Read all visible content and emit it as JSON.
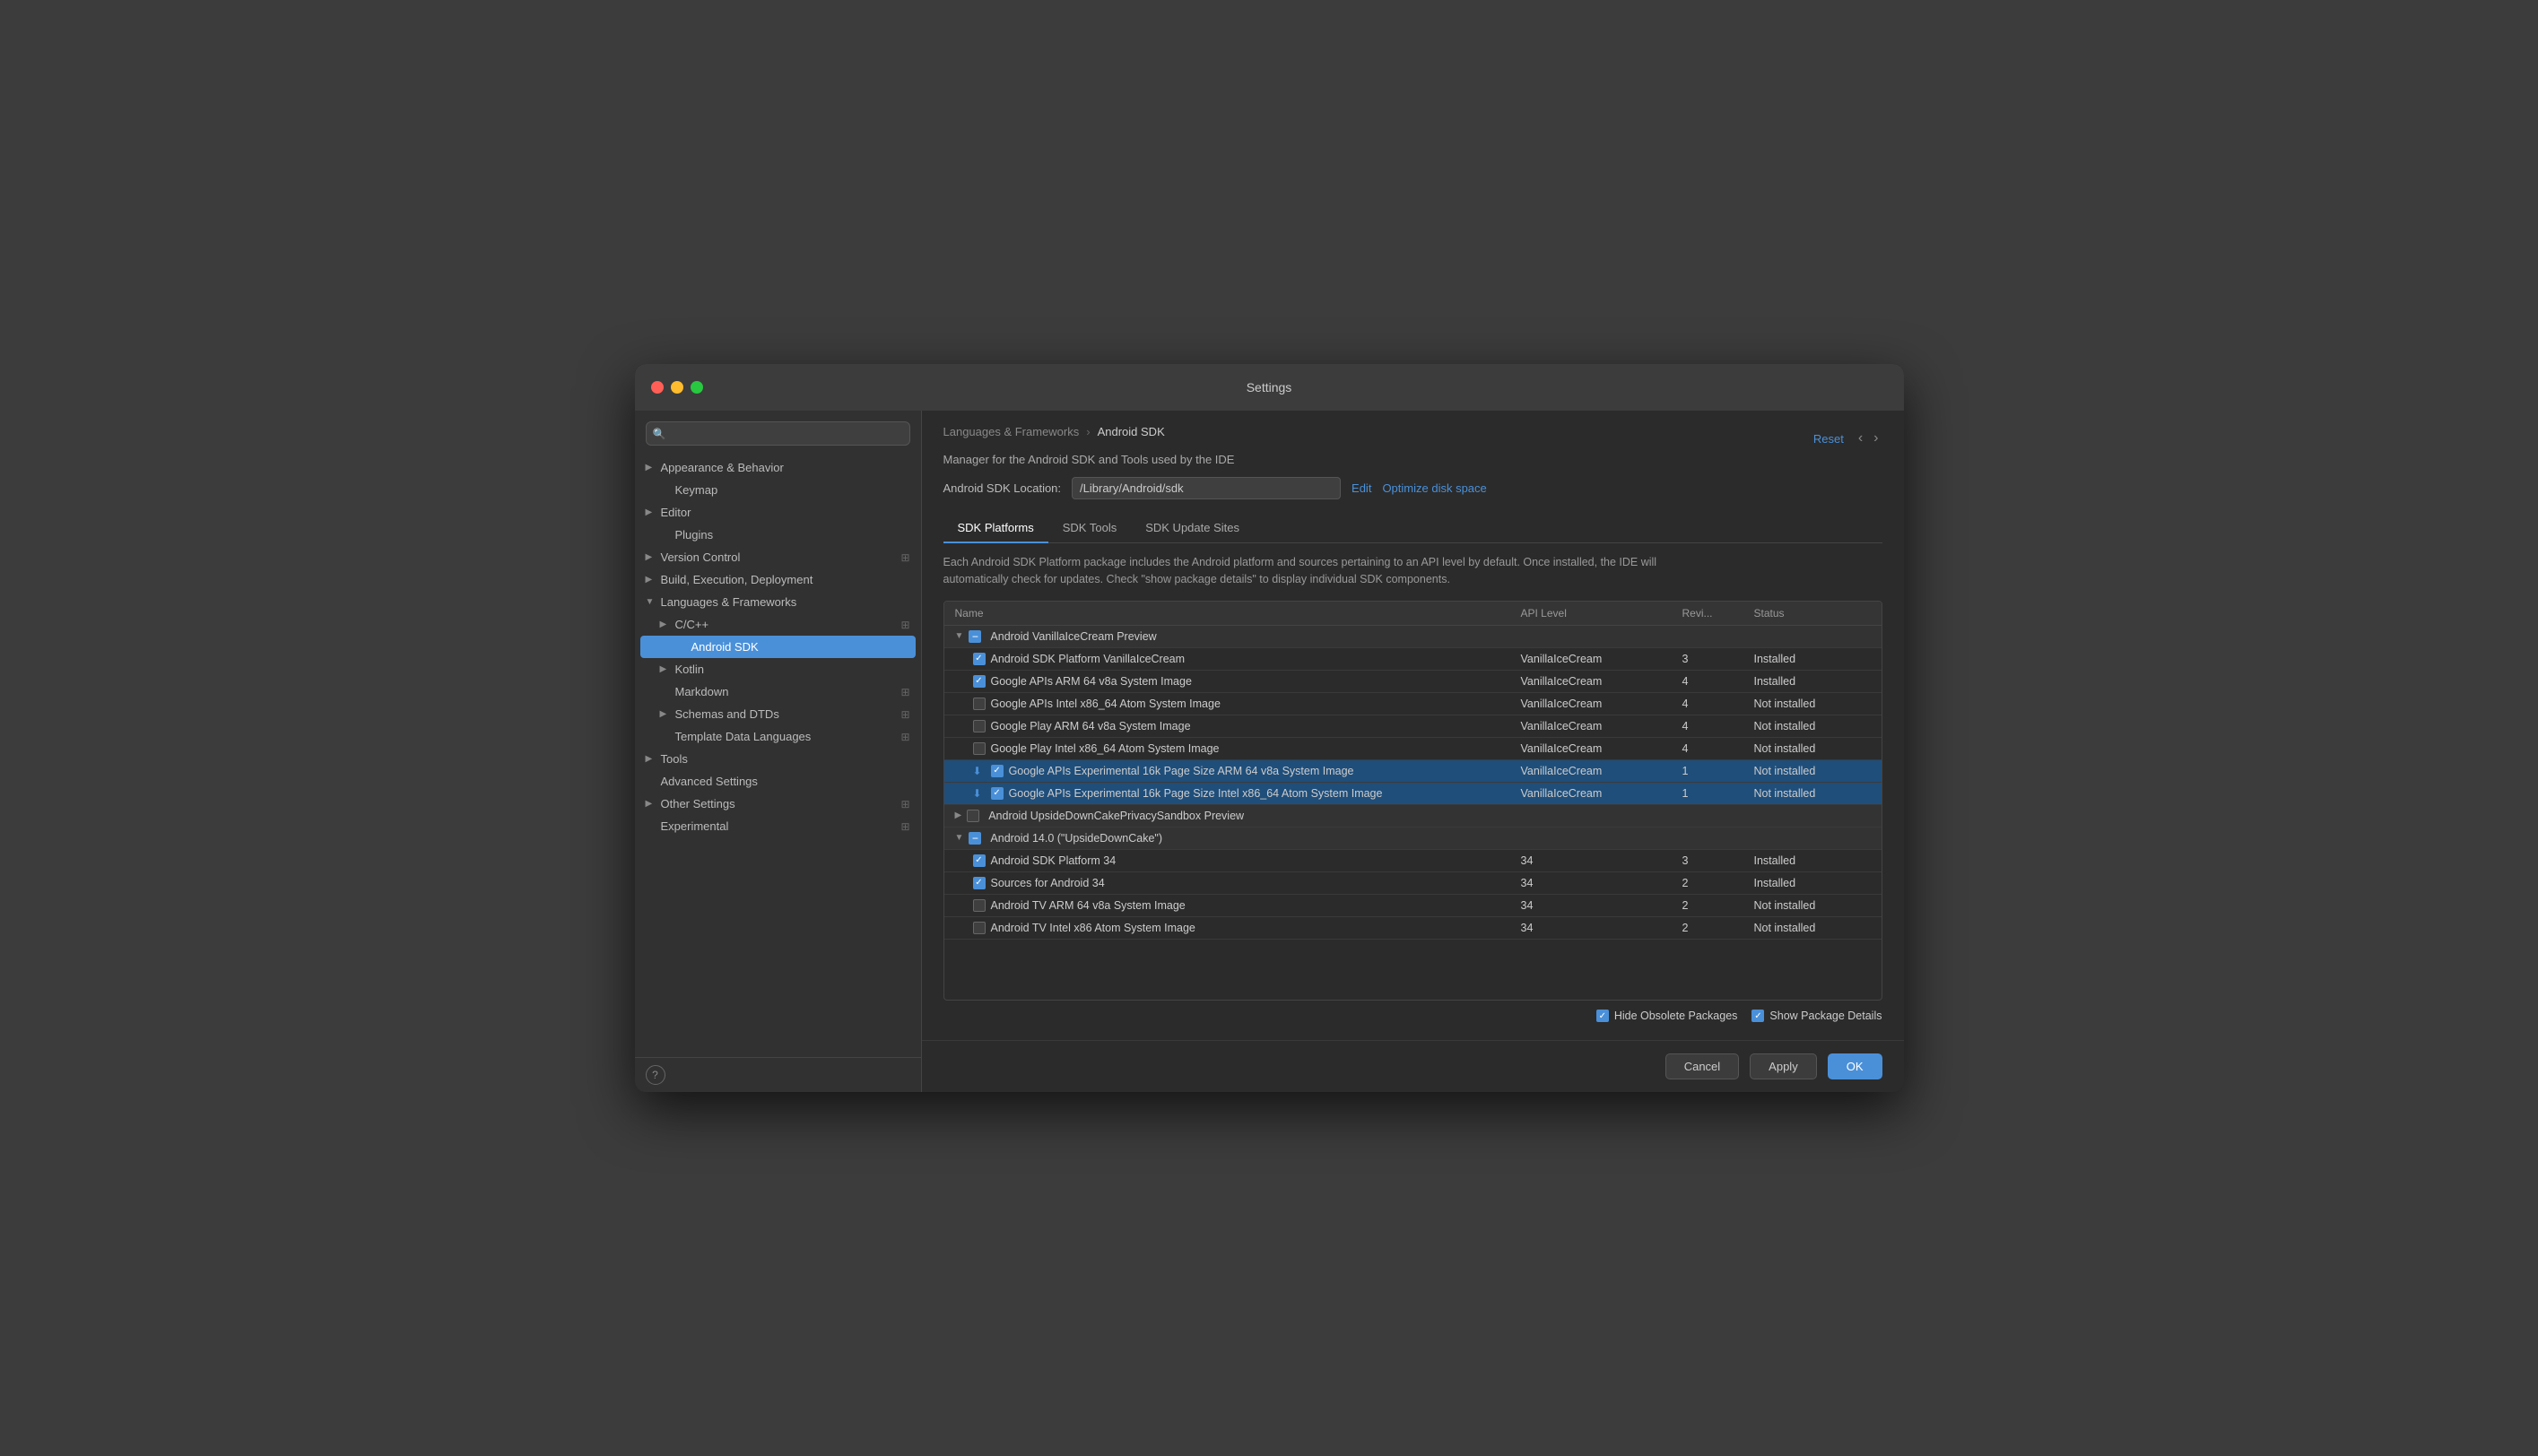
{
  "window": {
    "title": "Settings"
  },
  "sidebar": {
    "search_placeholder": "🔍",
    "items": [
      {
        "id": "appearance",
        "label": "Appearance & Behavior",
        "level": 0,
        "arrow": "▶",
        "icon_right": false,
        "active": false
      },
      {
        "id": "keymap",
        "label": "Keymap",
        "level": 1,
        "arrow": "",
        "icon_right": false,
        "active": false
      },
      {
        "id": "editor",
        "label": "Editor",
        "level": 0,
        "arrow": "▶",
        "icon_right": false,
        "active": false
      },
      {
        "id": "plugins",
        "label": "Plugins",
        "level": 1,
        "arrow": "",
        "icon_right": false,
        "active": false
      },
      {
        "id": "version-control",
        "label": "Version Control",
        "level": 0,
        "arrow": "▶",
        "icon_right": true,
        "active": false
      },
      {
        "id": "build-execution",
        "label": "Build, Execution, Deployment",
        "level": 0,
        "arrow": "▶",
        "icon_right": false,
        "active": false
      },
      {
        "id": "languages-frameworks",
        "label": "Languages & Frameworks",
        "level": 0,
        "arrow": "▼",
        "icon_right": false,
        "active": false
      },
      {
        "id": "cpp",
        "label": "C/C++",
        "level": 1,
        "arrow": "▶",
        "icon_right": true,
        "active": false
      },
      {
        "id": "android-sdk",
        "label": "Android SDK",
        "level": 2,
        "arrow": "",
        "icon_right": false,
        "active": true
      },
      {
        "id": "kotlin",
        "label": "Kotlin",
        "level": 1,
        "arrow": "▶",
        "icon_right": false,
        "active": false
      },
      {
        "id": "markdown",
        "label": "Markdown",
        "level": 1,
        "arrow": "",
        "icon_right": true,
        "active": false
      },
      {
        "id": "schemas-dtds",
        "label": "Schemas and DTDs",
        "level": 1,
        "arrow": "▶",
        "icon_right": true,
        "active": false
      },
      {
        "id": "template-data",
        "label": "Template Data Languages",
        "level": 1,
        "arrow": "",
        "icon_right": true,
        "active": false
      },
      {
        "id": "tools",
        "label": "Tools",
        "level": 0,
        "arrow": "▶",
        "icon_right": false,
        "active": false
      },
      {
        "id": "advanced-settings",
        "label": "Advanced Settings",
        "level": 0,
        "arrow": "",
        "icon_right": false,
        "active": false
      },
      {
        "id": "other-settings",
        "label": "Other Settings",
        "level": 0,
        "arrow": "▶",
        "icon_right": true,
        "active": false
      },
      {
        "id": "experimental",
        "label": "Experimental",
        "level": 0,
        "arrow": "",
        "icon_right": true,
        "active": false
      }
    ]
  },
  "main": {
    "breadcrumb": {
      "parent": "Languages & Frameworks",
      "child": "Android SDK"
    },
    "description": "Manager for the Android SDK and Tools used by the IDE",
    "sdk_location_label": "Android SDK Location:",
    "sdk_location_value": "/Library/Android/sdk",
    "edit_label": "Edit",
    "optimize_label": "Optimize disk space",
    "reset_label": "Reset",
    "tabs": [
      {
        "id": "sdk-platforms",
        "label": "SDK Platforms",
        "active": true
      },
      {
        "id": "sdk-tools",
        "label": "SDK Tools",
        "active": false
      },
      {
        "id": "sdk-update-sites",
        "label": "SDK Update Sites",
        "active": false
      }
    ],
    "table_description": "Each Android SDK Platform package includes the Android platform and sources pertaining to an API level by default. Once installed, the IDE will automatically check for updates. Check \"show package details\" to display individual SDK components.",
    "columns": [
      {
        "id": "name",
        "label": "Name"
      },
      {
        "id": "api-level",
        "label": "API Level"
      },
      {
        "id": "revision",
        "label": "Revi..."
      },
      {
        "id": "status",
        "label": "Status"
      }
    ],
    "groups": [
      {
        "id": "vanilla-ice-cream",
        "name": "Android VanillaIceCream Preview",
        "expanded": true,
        "checked": "indeterminate",
        "rows": [
          {
            "name": "Android SDK Platform VanillaIceCream",
            "api_level": "VanillaIceCream",
            "revision": "3",
            "status": "Installed",
            "checked": true,
            "download": false,
            "selected": false
          },
          {
            "name": "Google APIs ARM 64 v8a System Image",
            "api_level": "VanillaIceCream",
            "revision": "4",
            "status": "Installed",
            "checked": true,
            "download": false,
            "selected": false
          },
          {
            "name": "Google APIs Intel x86_64 Atom System Image",
            "api_level": "VanillaIceCream",
            "revision": "4",
            "status": "Not installed",
            "checked": false,
            "download": false,
            "selected": false
          },
          {
            "name": "Google Play ARM 64 v8a System Image",
            "api_level": "VanillaIceCream",
            "revision": "4",
            "status": "Not installed",
            "checked": false,
            "download": false,
            "selected": false
          },
          {
            "name": "Google Play Intel x86_64 Atom System Image",
            "api_level": "VanillaIceCream",
            "revision": "4",
            "status": "Not installed",
            "checked": false,
            "download": false,
            "selected": false
          },
          {
            "name": "Google APIs Experimental 16k Page Size ARM 64 v8a System Image",
            "api_level": "VanillaIceCream",
            "revision": "1",
            "status": "Not installed",
            "checked": true,
            "download": true,
            "selected": true
          },
          {
            "name": "Google APIs Experimental 16k Page Size Intel x86_64 Atom System Image",
            "api_level": "VanillaIceCream",
            "revision": "1",
            "status": "Not installed",
            "checked": true,
            "download": true,
            "selected": true
          }
        ]
      },
      {
        "id": "upside-down-cake-privacy",
        "name": "Android UpsideDownCakePrivacySandbox Preview",
        "expanded": false,
        "checked": false,
        "rows": []
      },
      {
        "id": "upside-down-cake",
        "name": "Android 14.0 (\"UpsideDownCake\")",
        "expanded": true,
        "checked": "indeterminate",
        "rows": [
          {
            "name": "Android SDK Platform 34",
            "api_level": "34",
            "revision": "3",
            "status": "Installed",
            "checked": true,
            "download": false,
            "selected": false
          },
          {
            "name": "Sources for Android 34",
            "api_level": "34",
            "revision": "2",
            "status": "Installed",
            "checked": true,
            "download": false,
            "selected": false
          },
          {
            "name": "Android TV ARM 64 v8a System Image",
            "api_level": "34",
            "revision": "2",
            "status": "Not installed",
            "checked": false,
            "download": false,
            "selected": false
          },
          {
            "name": "Android TV Intel x86 Atom System Image",
            "api_level": "34",
            "revision": "2",
            "status": "Not installed",
            "checked": false,
            "download": false,
            "selected": false
          }
        ]
      }
    ],
    "footer": {
      "hide_obsolete_label": "Hide Obsolete Packages",
      "hide_obsolete_checked": true,
      "show_package_label": "Show Package Details",
      "show_package_checked": true
    },
    "buttons": {
      "cancel": "Cancel",
      "apply": "Apply",
      "ok": "OK"
    }
  }
}
